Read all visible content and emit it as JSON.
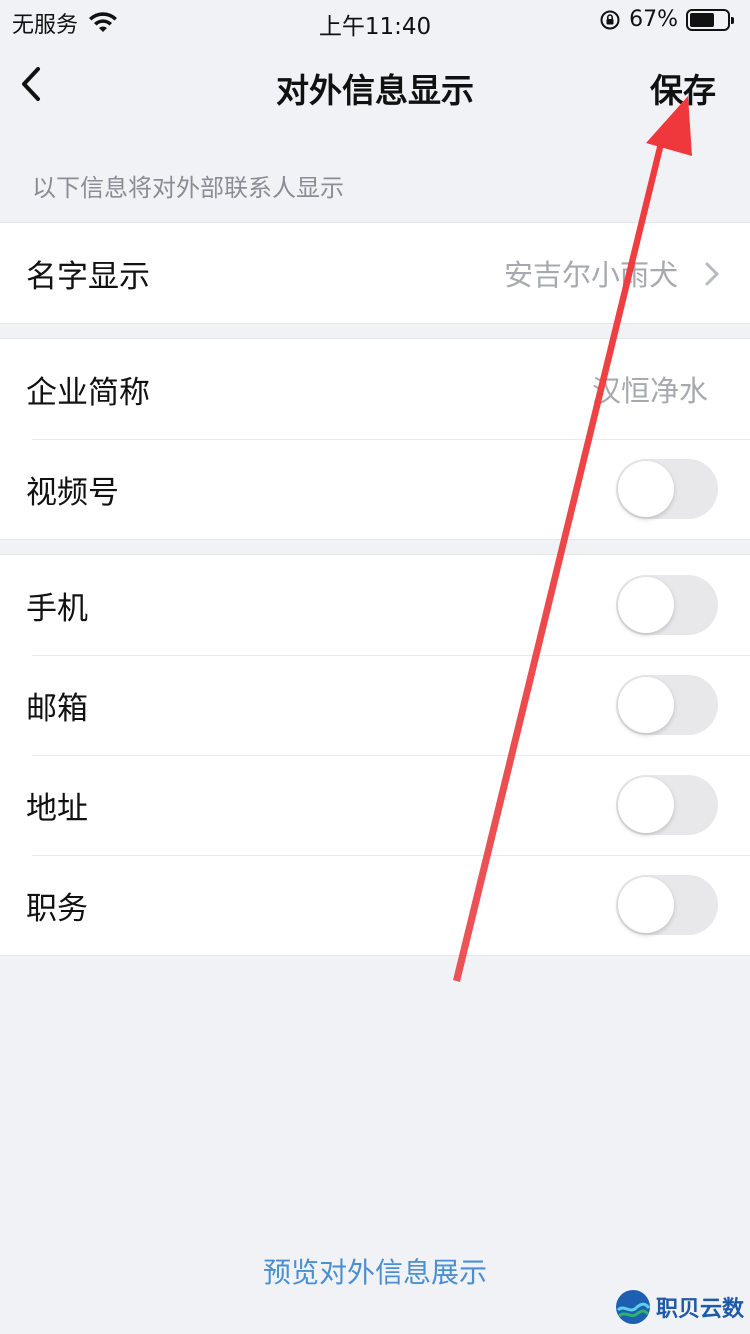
{
  "status_bar": {
    "carrier": "无服务",
    "time": "上午11:40",
    "battery_percent": "67%",
    "battery_level": 0.67
  },
  "nav": {
    "title": "对外信息显示",
    "save_label": "保存"
  },
  "hint": "以下信息将对外部联系人显示",
  "group1": {
    "name_row": {
      "label": "名字显示",
      "value": "安吉尔小雨犬"
    }
  },
  "group2": {
    "company_row": {
      "label": "企业简称",
      "value": "汉恒净水"
    },
    "video_row": {
      "label": "视频号",
      "enabled": false
    }
  },
  "group3": {
    "rows": [
      {
        "label": "手机",
        "enabled": false
      },
      {
        "label": "邮箱",
        "enabled": false
      },
      {
        "label": "地址",
        "enabled": false
      },
      {
        "label": "职务",
        "enabled": false
      }
    ]
  },
  "preview_link": "预览对外信息展示",
  "watermark": "职贝云数",
  "colors": {
    "background": "#f1f2f6",
    "link": "#4a8fcf",
    "annotation_arrow": "#e8373a",
    "toggle_off": "#e8e8ea"
  }
}
